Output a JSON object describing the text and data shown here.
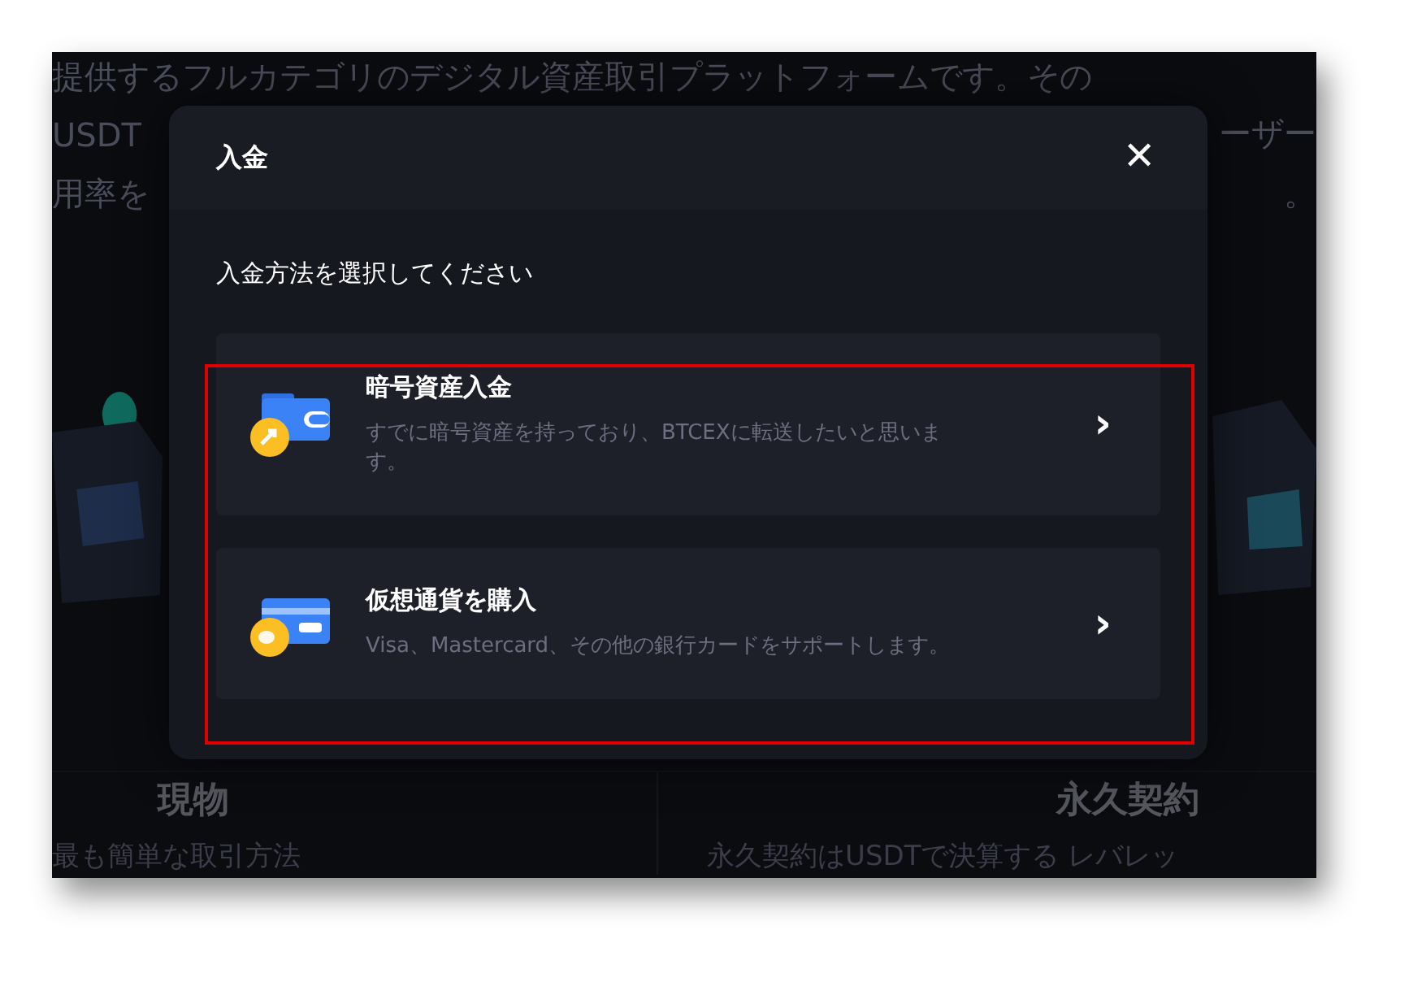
{
  "background": {
    "lines": [
      {
        "left": "提供するフルカテゴリのデジタル資産取引プラットフォームです。その"
      },
      {
        "left": "USDT",
        "right": "ーザー"
      },
      {
        "left": "用率を",
        "right": "。"
      }
    ],
    "products": [
      {
        "title": "現物",
        "description": "最も簡単な取引方法"
      },
      {
        "title": "永久契約",
        "description": "永久契約はUSDTで決算する レバレッ"
      }
    ]
  },
  "dialog": {
    "title": "入金",
    "close": "✕",
    "prompt": "入金方法を選択してください",
    "options": [
      {
        "kind": "wallet",
        "title": "暗号資産入金",
        "description": "すでに暗号資産を持っており、BTCEXに転送したいと思います。",
        "arrow": "›"
      },
      {
        "kind": "card",
        "title": "仮想通貨を購入",
        "description": "Visa、Mastercard、その他の銀行カードをサポートします。",
        "arrow": "›"
      }
    ]
  }
}
